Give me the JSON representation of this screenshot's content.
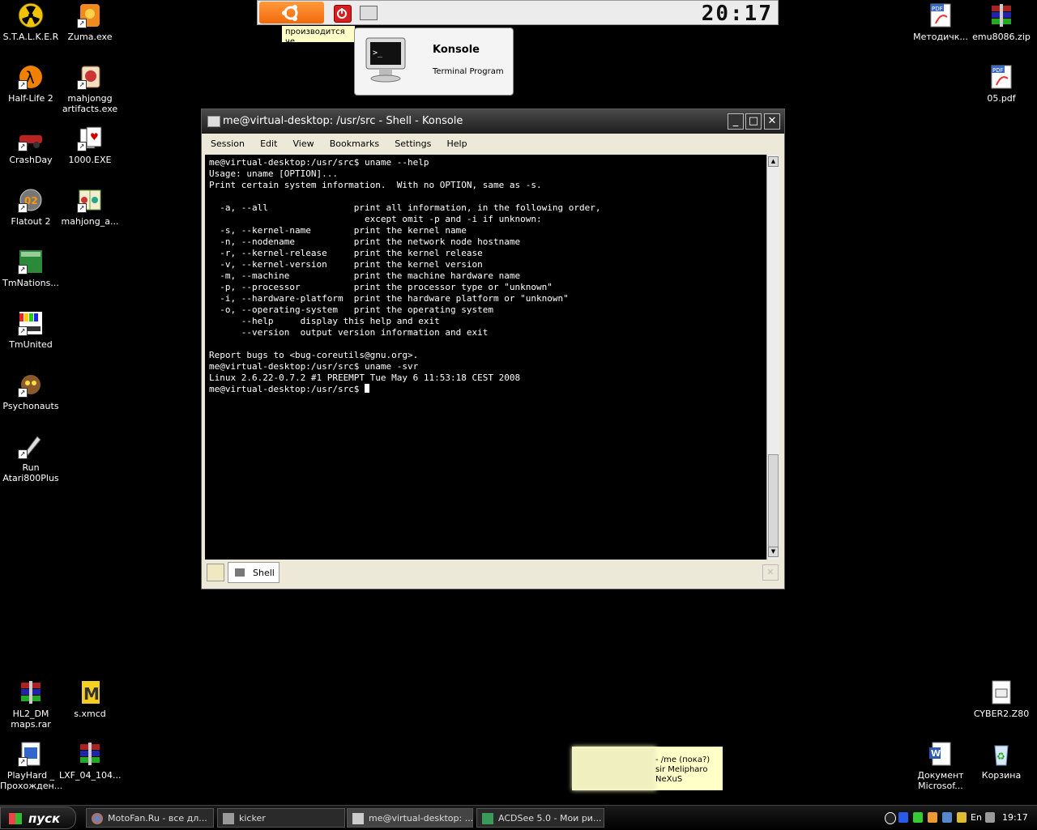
{
  "desktop": {
    "icons_left": [
      {
        "label": "S.T.A.L.K.E.R",
        "icon": "radiation-icon"
      },
      {
        "label": "Zuma.exe",
        "icon": "zuma-icon"
      },
      {
        "label": "Half-Life 2",
        "icon": "half-life-icon"
      },
      {
        "label": "mahjongg artifacts.exe",
        "icon": "mahjong-icon"
      },
      {
        "label": "CrashDay",
        "icon": "car-icon"
      },
      {
        "label": "1000.EXE",
        "icon": "cards-icon"
      },
      {
        "label": "Flatout 2",
        "icon": "flatout-icon"
      },
      {
        "label": "mahjong_a...",
        "icon": "mahjong-icon"
      },
      {
        "label": "TmNations...",
        "icon": "tmnations-icon"
      },
      {
        "label": "TmUnited",
        "icon": "tmunited-icon"
      },
      {
        "label": "Psychonauts",
        "icon": "psychonauts-icon"
      },
      {
        "label": "Run Atari800Plus",
        "icon": "atari-icon"
      },
      {
        "label": "HL2_DM maps.rar",
        "icon": "rar-icon"
      },
      {
        "label": "s.xmcd",
        "icon": "xmcd-icon"
      },
      {
        "label": "PlayHard _ Прохожден...",
        "icon": "document-icon"
      },
      {
        "label": "LXF_04_104...",
        "icon": "rar-icon"
      }
    ],
    "icons_right": [
      {
        "label": "Методичк...",
        "icon": "pdf-icon"
      },
      {
        "label": "emu8086.zip",
        "icon": "rar-icon"
      },
      {
        "label": "05.pdf",
        "icon": "pdf-icon"
      },
      {
        "label": "CYBER2.Z80",
        "icon": "file-icon"
      },
      {
        "label": "Документ Microsof...",
        "icon": "word-icon"
      },
      {
        "label": "Корзина",
        "icon": "recycle-bin-icon"
      }
    ]
  },
  "kicker": {
    "clock": "20:17",
    "tip_text": "производится че"
  },
  "tooltip": {
    "title": "Konsole",
    "subtitle": "Terminal Program"
  },
  "window": {
    "title": "me@virtual-desktop: /usr/src - Shell - Konsole",
    "menu": [
      "Session",
      "Edit",
      "View",
      "Bookmarks",
      "Settings",
      "Help"
    ],
    "terminal_text": "me@virtual-desktop:/usr/src$ uname --help\nUsage: uname [OPTION]...\nPrint certain system information.  With no OPTION, same as -s.\n\n  -a, --all                print all information, in the following order,\n                             except omit -p and -i if unknown:\n  -s, --kernel-name        print the kernel name\n  -n, --nodename           print the network node hostname\n  -r, --kernel-release     print the kernel release\n  -v, --kernel-version     print the kernel version\n  -m, --machine            print the machine hardware name\n  -p, --processor          print the processor type or \"unknown\"\n  -i, --hardware-platform  print the hardware platform or \"unknown\"\n  -o, --operating-system   print the operating system\n      --help     display this help and exit\n      --version  output version information and exit\n\nReport bugs to <bug-coreutils@gnu.org>.\nme@virtual-desktop:/usr/src$ uname -svr\nLinux 2.6.22-0.7.2 #1 PREEMPT Tue May 6 11:53:18 CEST 2008\n",
    "prompt": "me@virtual-desktop:/usr/src$ ",
    "tab_label": "Shell"
  },
  "note": {
    "text": "- /me (пока?)\nsir Melipharo\nNeXuS"
  },
  "taskbar": {
    "start_label": "пуск",
    "tasks": [
      {
        "label": "MotoFan.Ru - все дл...",
        "icon": "firefox-icon"
      },
      {
        "label": "kicker",
        "icon": "kicker-icon"
      },
      {
        "label": "me@virtual-desktop: ...",
        "icon": "terminal-icon"
      },
      {
        "label": "ACDSee 5.0 - Мои ри...",
        "icon": "acdsee-icon"
      }
    ],
    "language": "En",
    "clock": "19:17"
  }
}
